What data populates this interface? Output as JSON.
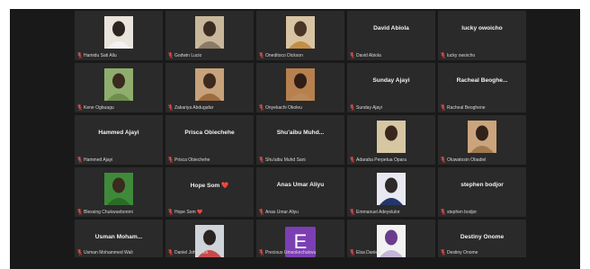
{
  "colors": {
    "frame_bg": "#191919",
    "tile_bg": "#2a2a2a",
    "mic_muted": "#e04b4b",
    "avatar_e": "#7b3fb3"
  },
  "participants": [
    {
      "display": "",
      "label": "Hamidu Sati Allu",
      "photo": true
    },
    {
      "display": "",
      "label": "Godwin Lucio",
      "photo": true
    },
    {
      "display": "",
      "label": "Oneditoco Dickson",
      "photo": true
    },
    {
      "display": "David Abiola",
      "label": "David Abiola",
      "photo": false
    },
    {
      "display": "lucky owoicho",
      "label": "lucky owoicho",
      "photo": false
    },
    {
      "display": "",
      "label": "Kene Ogbuagu",
      "photo": true
    },
    {
      "display": "",
      "label": "Zakariya Abdugafar",
      "photo": true
    },
    {
      "display": "",
      "label": "Onyekachi Okoleu",
      "photo": true
    },
    {
      "display": "Sunday Ajayi",
      "label": "Sunday Ajayi",
      "photo": false
    },
    {
      "display": "Racheal Beoghe...",
      "label": "Racheal Beoghene",
      "photo": false
    },
    {
      "display": "Hammed Ajayi",
      "label": "Hammed Ajayi",
      "photo": false
    },
    {
      "display": "Prisca Obiechehe",
      "label": "Prisca Obiechehe",
      "photo": false
    },
    {
      "display": "Shu'aibu Muhd...",
      "label": "Shu'aibu Muhd Sani",
      "photo": false
    },
    {
      "display": "",
      "label": "Adaraba Perpetua Opara",
      "photo": true
    },
    {
      "display": "",
      "label": "Oluwatosin Obadiel",
      "photo": true
    },
    {
      "display": "",
      "label": "Blessing Chukwuebonmi",
      "photo": true
    },
    {
      "display": "Hope Som ❤️",
      "label": "Hope Som ❤️",
      "photo": false
    },
    {
      "display": "Anas Umar Aliyu",
      "label": "Anas Umar Aliyu",
      "photo": false
    },
    {
      "display": "",
      "label": "Emmanuel Adeyelulor",
      "photo": true
    },
    {
      "display": "stephen bodjor",
      "label": "stephen bodjor",
      "photo": false
    },
    {
      "display": "Usman Moham...",
      "label": "Usman Mohammed Wali",
      "photo": false
    },
    {
      "display": "",
      "label": "Daniel Johannes",
      "photo": true
    },
    {
      "display": "",
      "label": "Precious Umeokechukwu",
      "photo": false,
      "letter": "E"
    },
    {
      "display": "",
      "label": "Elsa Daniels",
      "photo": true
    },
    {
      "display": "Destiny Onome",
      "label": "Destiny Onome",
      "photo": false
    }
  ]
}
